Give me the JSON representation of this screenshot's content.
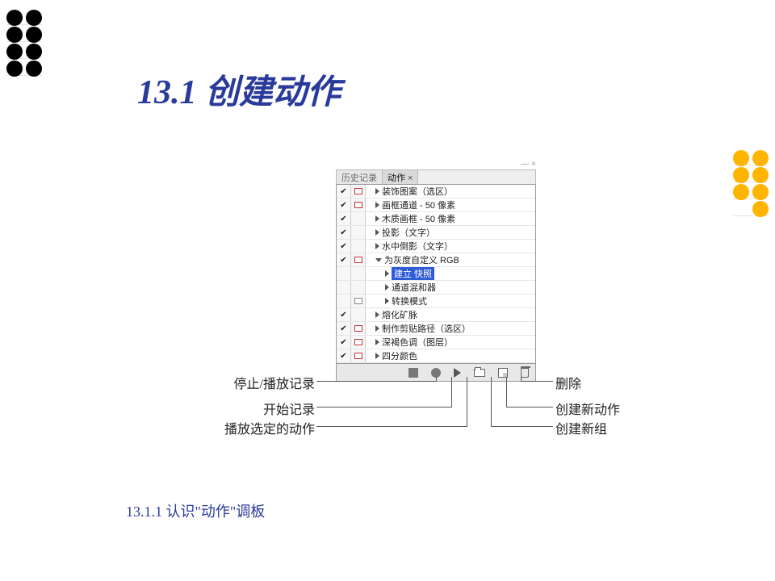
{
  "title": "13.1   创建动作",
  "sub_heading": {
    "num": "13.1.1",
    "text": "  认识\"动作\"调板"
  },
  "panel": {
    "tabs": {
      "history": "历史记录",
      "actions": "动作"
    },
    "rows": [
      {
        "chk": true,
        "dlg": "red",
        "indent": 1,
        "arrow": "right",
        "label": "装饰图案（选区）"
      },
      {
        "chk": true,
        "dlg": "red",
        "indent": 1,
        "arrow": "right",
        "label": "画框通道 - 50 像素"
      },
      {
        "chk": true,
        "dlg": "",
        "indent": 1,
        "arrow": "right",
        "label": "木质画框 - 50 像素"
      },
      {
        "chk": true,
        "dlg": "",
        "indent": 1,
        "arrow": "right",
        "label": "投影（文字）"
      },
      {
        "chk": true,
        "dlg": "",
        "indent": 1,
        "arrow": "right",
        "label": "水中倒影（文字）"
      },
      {
        "chk": true,
        "dlg": "red",
        "indent": 1,
        "arrow": "down",
        "label": "为灰度自定义 RGB"
      },
      {
        "chk": false,
        "dlg": "",
        "indent": 2,
        "arrow": "right",
        "label": "建立 快照",
        "selected": true
      },
      {
        "chk": false,
        "dlg": "",
        "indent": 2,
        "arrow": "right",
        "label": "通道混和器"
      },
      {
        "chk": false,
        "dlg": "gray",
        "indent": 2,
        "arrow": "right",
        "label": "转换模式"
      },
      {
        "chk": true,
        "dlg": "",
        "indent": 1,
        "arrow": "right",
        "label": "熔化矿脉"
      },
      {
        "chk": true,
        "dlg": "red",
        "indent": 1,
        "arrow": "right",
        "label": "制作剪贴路径（选区）"
      },
      {
        "chk": true,
        "dlg": "red",
        "indent": 1,
        "arrow": "right",
        "label": "深褐色调（图层）"
      },
      {
        "chk": true,
        "dlg": "red",
        "indent": 1,
        "arrow": "right",
        "label": "四分颜色"
      }
    ],
    "footer_icons": [
      "stop",
      "record",
      "play",
      "folder",
      "new",
      "trash"
    ]
  },
  "callouts": {
    "left": [
      {
        "label": "停止/播放记录"
      },
      {
        "label": "开始记录"
      },
      {
        "label": "播放选定的动作"
      }
    ],
    "right": [
      {
        "label": "删除"
      },
      {
        "label": "创建新动作"
      },
      {
        "label": "创建新组"
      }
    ]
  }
}
